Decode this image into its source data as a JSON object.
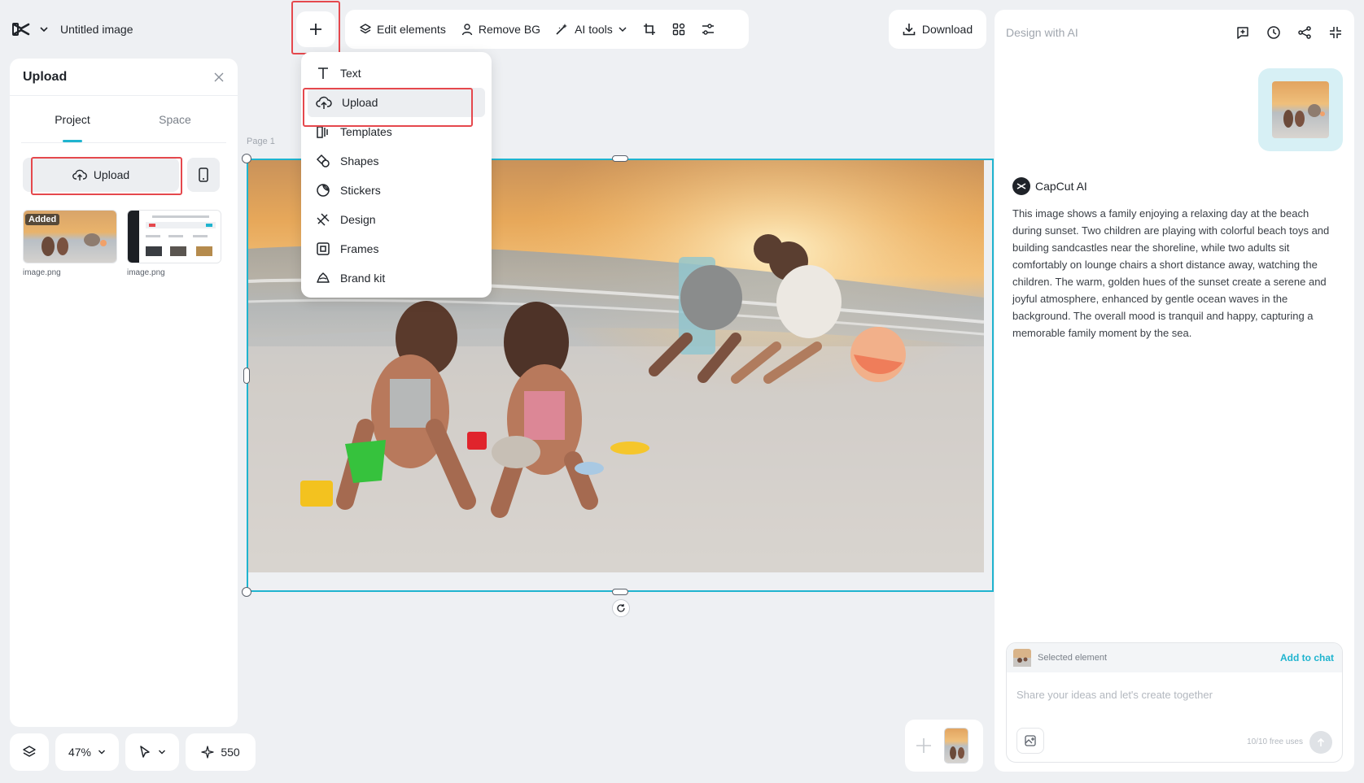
{
  "app": {
    "title": "Untitled image"
  },
  "toolbar": {
    "add_label": "+",
    "edit_elements": "Edit elements",
    "remove_bg": "Remove BG",
    "ai_tools": "AI tools",
    "download": "Download"
  },
  "add_menu": {
    "items": [
      "Text",
      "Upload",
      "Templates",
      "Shapes",
      "Stickers",
      "Design",
      "Frames",
      "Brand kit"
    ],
    "highlighted": "Upload"
  },
  "left_panel": {
    "title": "Upload",
    "tabs": [
      "Project",
      "Space"
    ],
    "active_tab": "Project",
    "upload_label": "Upload",
    "assets": [
      {
        "name": "image.png",
        "badge": "Added"
      },
      {
        "name": "image.png",
        "badge": ""
      }
    ]
  },
  "bottom_controls": {
    "zoom": "47%",
    "credits": "550"
  },
  "canvas": {
    "page_label": "Page 1"
  },
  "right_panel": {
    "placeholder_title": "Design with AI",
    "ai_name": "CapCut AI",
    "ai_response": "This image shows a family enjoying a relaxing day at the beach during sunset. Two children are playing with colorful beach toys and building sandcastles near the shoreline, while two adults sit comfortably on lounge chairs a short distance away, watching the children. The warm, golden hues of the sunset create a serene and joyful atmosphere, enhanced by gentle ocean waves in the background. The overall mood is tranquil and happy, capturing a memorable family moment by the sea.",
    "selected_element": "Selected element",
    "add_to_chat": "Add to chat",
    "input_placeholder": "Share your ideas and let's create together",
    "free_uses": "10/10 free uses"
  },
  "colors": {
    "accent": "#1fb4cf",
    "highlight_box": "#e5484d",
    "panel_bg": "#ffffff",
    "app_bg": "#eef0f3"
  }
}
